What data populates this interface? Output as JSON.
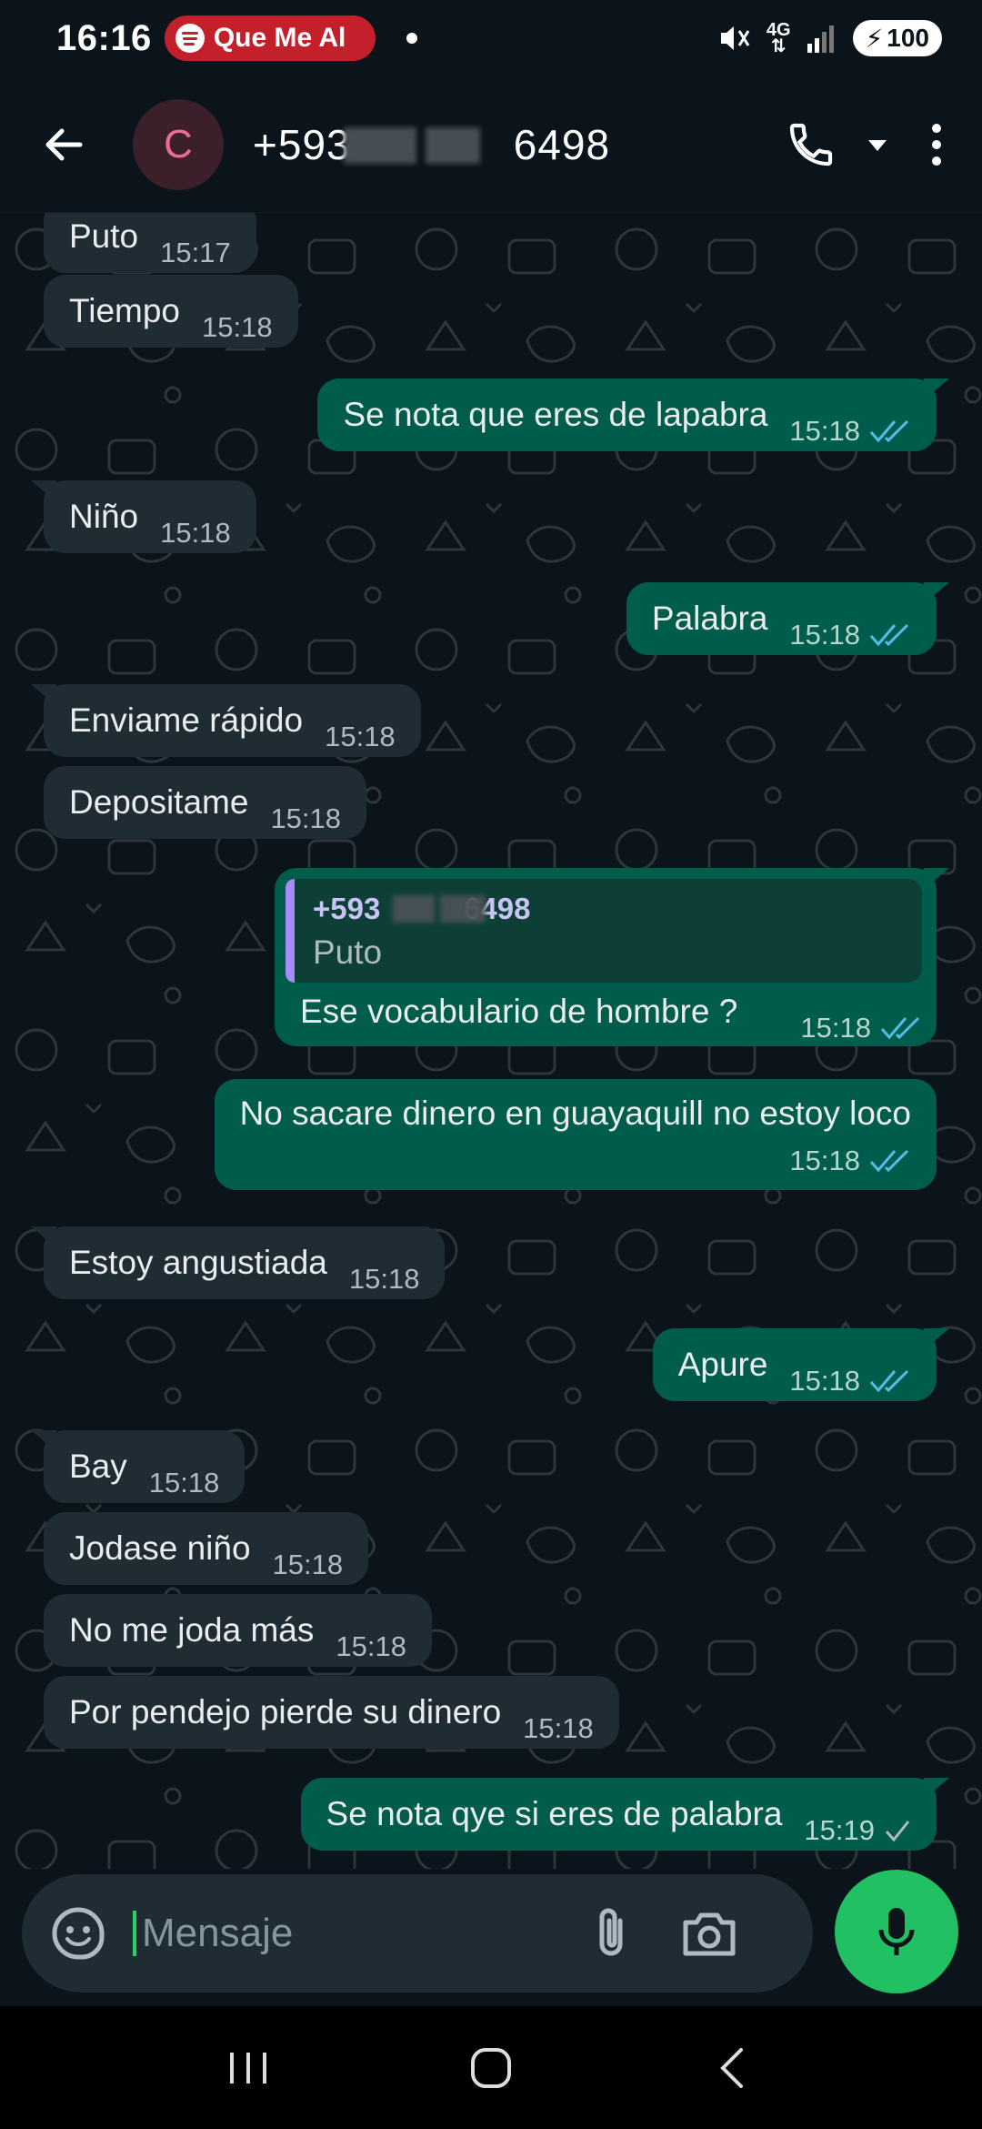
{
  "status_bar": {
    "time": "16:16",
    "media_track": "Que Me Al",
    "network": "4G",
    "battery": "100"
  },
  "header": {
    "avatar_letter": "C",
    "contact_number": "+593             6498"
  },
  "messages": [
    {
      "dir": "in",
      "text": "Puto",
      "time": "15:17"
    },
    {
      "dir": "in",
      "text": "Tiempo",
      "time": "15:18"
    },
    {
      "dir": "out",
      "text": "Se nota que eres de lapabra",
      "time": "15:18",
      "status": "read"
    },
    {
      "dir": "in",
      "text": "Niño",
      "time": "15:18"
    },
    {
      "dir": "out",
      "text": "Palabra",
      "time": "15:18",
      "status": "read"
    },
    {
      "dir": "in",
      "text": "Enviame rápido",
      "time": "15:18"
    },
    {
      "dir": "in",
      "text": "Depositame",
      "time": "15:18"
    },
    {
      "dir": "out",
      "text": "Ese vocabulario de hombre ?",
      "time": "15:18",
      "status": "read",
      "reply": {
        "author": "+593          6498",
        "text": "Puto"
      }
    },
    {
      "dir": "out",
      "text": "No sacare dinero en guayaquill no estoy loco",
      "time": "15:18",
      "status": "read"
    },
    {
      "dir": "in",
      "text": "Estoy angustiada",
      "time": "15:18"
    },
    {
      "dir": "out",
      "text": "Apure",
      "time": "15:18",
      "status": "read"
    },
    {
      "dir": "in",
      "text": "Bay",
      "time": "15:18"
    },
    {
      "dir": "in",
      "text": "Jodase niño",
      "time": "15:18"
    },
    {
      "dir": "in",
      "text": "No me joda más",
      "time": "15:18"
    },
    {
      "dir": "in",
      "text": "Por pendejo pierde su dinero",
      "time": "15:18"
    },
    {
      "dir": "out",
      "text": "Se nota qye si eres de palabra",
      "time": "15:19",
      "status": "sent"
    }
  ],
  "composer": {
    "placeholder": "Mensaje"
  },
  "colors": {
    "background": "#0b141a",
    "incoming_bubble": "#202c33",
    "outgoing_bubble": "#005c4b",
    "read_tick": "#53bdeb",
    "sent_tick": "#aebac1",
    "mic_button": "#21c063",
    "avatar_bg": "#3b1f2b",
    "avatar_letter": "#e86b95"
  },
  "icons": {
    "back": "arrow-left-icon",
    "call": "phone-icon",
    "call_menu": "caret-down-icon",
    "more": "more-vertical-icon",
    "sticker": "sticker-icon",
    "attach": "paperclip-icon",
    "camera": "camera-icon",
    "mic": "mic-icon",
    "nav_recents": "recents-icon",
    "nav_home": "home-icon",
    "nav_back": "nav-back-icon"
  }
}
